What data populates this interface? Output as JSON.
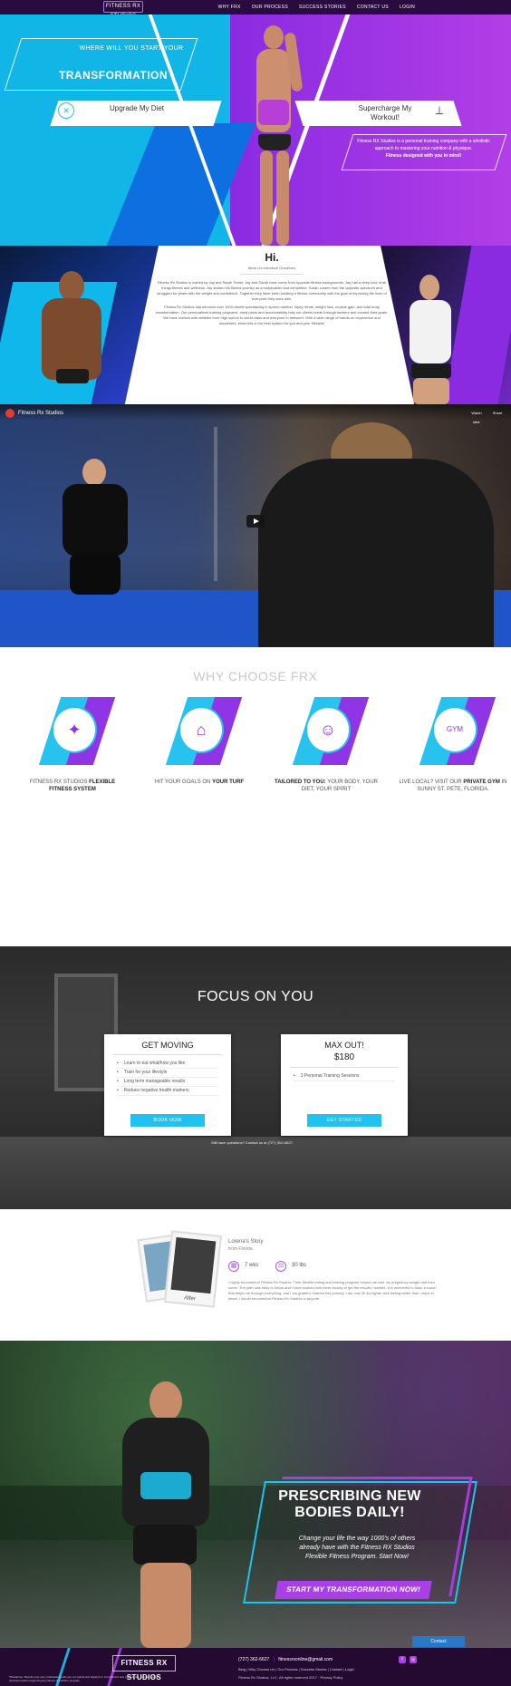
{
  "nav": {
    "logo_text": "FITNESS RX STUDIOS",
    "links": [
      "WHY FRX",
      "OUR PROCESS",
      "SUCCESS STORIES",
      "CONTACT US",
      "LOGIN"
    ]
  },
  "hero": {
    "kicker": "WHERE WILL YOU START YOUR",
    "title": "TRANSFORMATION",
    "left_pill": "Upgrade My Diet",
    "right_pill": "Supercharge My Workout!",
    "intro_line1": "Fitness RX Studios is a personal training company with a wholistic approach to mastering your nutrition & physique.",
    "intro_line2": "Fitness designed with you in mind!"
  },
  "about": {
    "title": "Hi.",
    "subtitle": "Allow Us Introduce Ourselves",
    "paragraph1": "Fitness Rx Studios is owned by Jay and Sarah Tinnin. Jay and Sarah have come from opposite fitness backgrounds. Jay has a deep love of all things fitness and wellness. Jay started his fitness journey as a bodybuilder and competitor. Sarah comes from the opposite spectrum and struggled for years with her weight and confidence. Together they have been building a fitness community with the goal of improving the lives of everyone they work with.",
    "paragraph2": "Fitness Rx Studios has serviced over 1000 clients specializing in sports nutrition, injury rehab, weight loss, muscle gain, and total body transformation. Our personalized training programs, meal plans and accountability help our clients break through barriers and exceed their goals. We have worked with athletes from high school to world class and everyone in between. With a wide range of hands-on experience and successes, know this is the best system for you and your lifestyle!"
  },
  "video": {
    "title": "Fitness Rx Studios",
    "watch_later": "Watch later",
    "share": "Share"
  },
  "why": {
    "title": "WHY CHOOSE FRX",
    "items": [
      {
        "icon": "flexible-fitness-icon",
        "pre": "FITNESS RX STUDIOS ",
        "bold": "FLEXIBLE FITNESS SYSTEM",
        "post": ""
      },
      {
        "icon": "home-icon",
        "pre": "HIT YOUR GOALS ON ",
        "bold": "YOUR TURF",
        "post": ""
      },
      {
        "icon": "tailored-icon",
        "pre": "",
        "bold": "TAILORED TO YOU:",
        "post": " YOUR BODY, YOUR DIET, YOUR SPIRIT"
      },
      {
        "icon": "gym-icon",
        "pre": "LIVE LOCAL? VISIT OUR ",
        "bold": "PRIVATE GYM",
        "post": " IN SUNNY ST. PETE, FLORIDA."
      }
    ],
    "gym_label": "GYM"
  },
  "focus": {
    "title": "FOCUS ON YOU",
    "card1": {
      "title": "GET MOVING",
      "items": [
        "Learn to eat what/how you like",
        "Train for your lifestyle",
        "Long term manageable results",
        "Reduce negative health markers"
      ],
      "button": "BOOK NOW"
    },
    "card2": {
      "title": "MAX OUT!",
      "price": "$180",
      "items": [
        "3 Personal Training Sessions"
      ],
      "button": "GET STARTED"
    },
    "note": "Still have questions? Contact us at (727) 362-6627"
  },
  "story": {
    "name": "Lorena's Story",
    "place": "from Florida",
    "photo_label": "After",
    "stats": [
      {
        "icon": "calendar-icon",
        "value": "7 wks"
      },
      {
        "icon": "scale-icon",
        "value": "30 lbs"
      }
    ],
    "text": "I highly recommend Fitness Rx Studios. Their flexible eating and training program helped me lose my pregnancy weight and then some. The plan was easy to follow and I have worked with them closely to get the results I wanted. It is wonderful to have a coach that helps me through everything, and I am grateful I started this journey. I am now 30 lbs lighter and feeling better than I have in years. I would recommend Fitness Rx Studios to anyone."
  },
  "cta": {
    "title": "PRESCRIBING NEW BODIES DAILY!",
    "body": "Change your life the way 1000's of others already have with the Fitness RX Studios Flexible Fitness Program. Start Now!",
    "button": "START MY TRANSFORMATION NOW!",
    "contact": "Contact"
  },
  "footer": {
    "logo": "FITNESS RX STUDIOS",
    "phone": "(727) 362-6627",
    "email": "fitnessrxonline@gmail.com",
    "links": "Blog | Why Choose Us | Our Process | Success Stories | Contact | Login",
    "copyright": "Fitness Rx Studios, LLC. All rights reserved 2017 · Privacy Policy",
    "disclaimer": "*Disclaimer: Results may vary. Individual results are not typical and depend on commitment and consistency. Consult with a physician before beginning any fitness or nutrition program."
  }
}
